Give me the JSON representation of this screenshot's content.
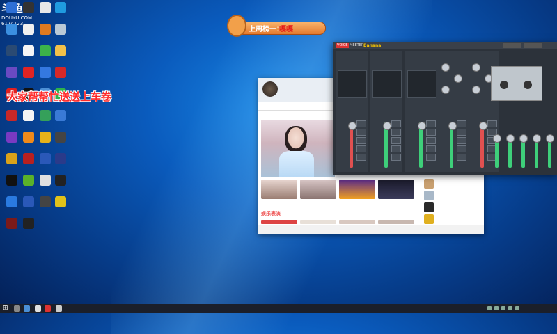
{
  "overlay": {
    "logo": "斗鱼",
    "logo_sub": "DOUYU.COM",
    "room_id": "6174123",
    "banner_text": "大家帮帮忙送送上车卷",
    "rank_label": "上周榜一：",
    "rank_name": "嘎嘎"
  },
  "desktop_icons": [
    {
      "icon": "blue-app-icon",
      "label": "",
      "color": "#2d6fd6"
    },
    {
      "icon": "obs-icon",
      "label": "",
      "color": "#333"
    },
    {
      "icon": "camera-icon",
      "label": "",
      "color": "#e8e8e8"
    },
    {
      "icon": "edge-icon",
      "label": "",
      "color": "#1f9be0"
    },
    {
      "icon": "mail-app-icon",
      "label": "",
      "color": "#3b8fe0"
    },
    {
      "icon": "penguin-icon",
      "label": "",
      "color": "#f0f0f0"
    },
    {
      "icon": "orange-app-icon",
      "label": "",
      "color": "#e07a1f"
    },
    {
      "icon": "recycle-icon",
      "label": "",
      "color": "#b9c9d6"
    },
    {
      "icon": "steam-icon",
      "label": "",
      "color": "#2a4a73"
    },
    {
      "icon": "qq-icon",
      "label": "",
      "color": "#f5f5f5"
    },
    {
      "icon": "green-app-icon",
      "label": "",
      "color": "#3cb34a"
    },
    {
      "icon": "folder-icon",
      "label": "",
      "color": "#f2c14a"
    },
    {
      "icon": "game-icon",
      "label": "",
      "color": "#6a4ac2"
    },
    {
      "icon": "s-app-icon",
      "label": "",
      "color": "#e02424"
    },
    {
      "icon": "image-app-icon",
      "label": "",
      "color": "#3478e0"
    },
    {
      "icon": "red-app-icon",
      "label": "",
      "color": "#d62828"
    },
    {
      "icon": "netease-icon",
      "label": "",
      "color": "#e02020"
    },
    {
      "icon": "douyin-icon",
      "label": "",
      "color": "#111"
    },
    {
      "icon": "monitor-icon",
      "label": "",
      "color": "#4c8fd6"
    },
    {
      "icon": "wechat-icon",
      "label": "",
      "color": "#2fb34a"
    },
    {
      "icon": "force-icon",
      "label": "",
      "color": "#c82828"
    },
    {
      "icon": "doc-icon",
      "label": "",
      "color": "#f4f4f4"
    },
    {
      "icon": "green-box-icon",
      "label": "",
      "color": "#35a05a"
    },
    {
      "icon": "blue-doc-icon",
      "label": "",
      "color": "#3a7ad6"
    },
    {
      "icon": "purple-app-icon",
      "label": "",
      "color": "#7a3ac2"
    },
    {
      "icon": "sun-app-icon",
      "label": "",
      "color": "#f08a1a"
    },
    {
      "icon": "yellow-app-icon",
      "label": "",
      "color": "#e6b21a"
    },
    {
      "icon": "car-icon",
      "label": "",
      "color": "#444"
    },
    {
      "icon": "brush-icon",
      "label": "",
      "color": "#d9a21a"
    },
    {
      "icon": "red-game-icon",
      "label": "",
      "color": "#b82020"
    },
    {
      "icon": "word-icon",
      "label": "",
      "color": "#2a58b8"
    },
    {
      "icon": "blue-game-icon",
      "label": "",
      "color": "#2a3a8a"
    },
    {
      "icon": "capcut-icon",
      "label": "",
      "color": "#111"
    },
    {
      "icon": "nvidia-icon",
      "label": "",
      "color": "#5ab22a"
    },
    {
      "icon": "chrome-icon",
      "label": "",
      "color": "#e0e0e0"
    },
    {
      "icon": "dark-app-icon",
      "label": "",
      "color": "#222"
    },
    {
      "icon": "ie-icon",
      "label": "",
      "color": "#2a7ae0"
    },
    {
      "icon": "w-app-icon",
      "label": "",
      "color": "#2a58b8"
    },
    {
      "icon": "box-app-icon",
      "label": "",
      "color": "#444"
    },
    {
      "icon": "yellow-ball-icon",
      "label": "",
      "color": "#e0c21a"
    },
    {
      "icon": "dark-red-icon",
      "label": "",
      "color": "#7a1a1a"
    },
    {
      "icon": "wheel-icon",
      "label": "",
      "color": "#222"
    }
  ],
  "app": {
    "streamer_name": "",
    "stats": "",
    "tabs": [
      "",
      "",
      "",
      "",
      ""
    ],
    "thumb_captions": [
      "",
      "",
      "",
      ""
    ],
    "section_title": "娱乐表演",
    "section_nav": "",
    "list": [
      {
        "title": "",
        "sub": ""
      },
      {
        "title": "",
        "sub": ""
      },
      {
        "title": "",
        "sub": ""
      },
      {
        "title": "",
        "sub": ""
      }
    ]
  },
  "voicemeeter": {
    "brand_tag": "VOICE",
    "brand_name": "MEETER",
    "edition": "Banana",
    "channels": [
      "",
      "",
      "",
      "",
      ""
    ],
    "menu_buttons": [
      "",
      ""
    ],
    "bus_buttons": [
      "",
      "",
      "",
      "",
      ""
    ],
    "accent_color": "#f0a020",
    "fader_colors": [
      "#e05050",
      "#3ecf7a",
      "#3ecf7a",
      "#3ecf7a",
      "#e05050"
    ]
  },
  "taskbar": {
    "time": "",
    "date": ""
  }
}
